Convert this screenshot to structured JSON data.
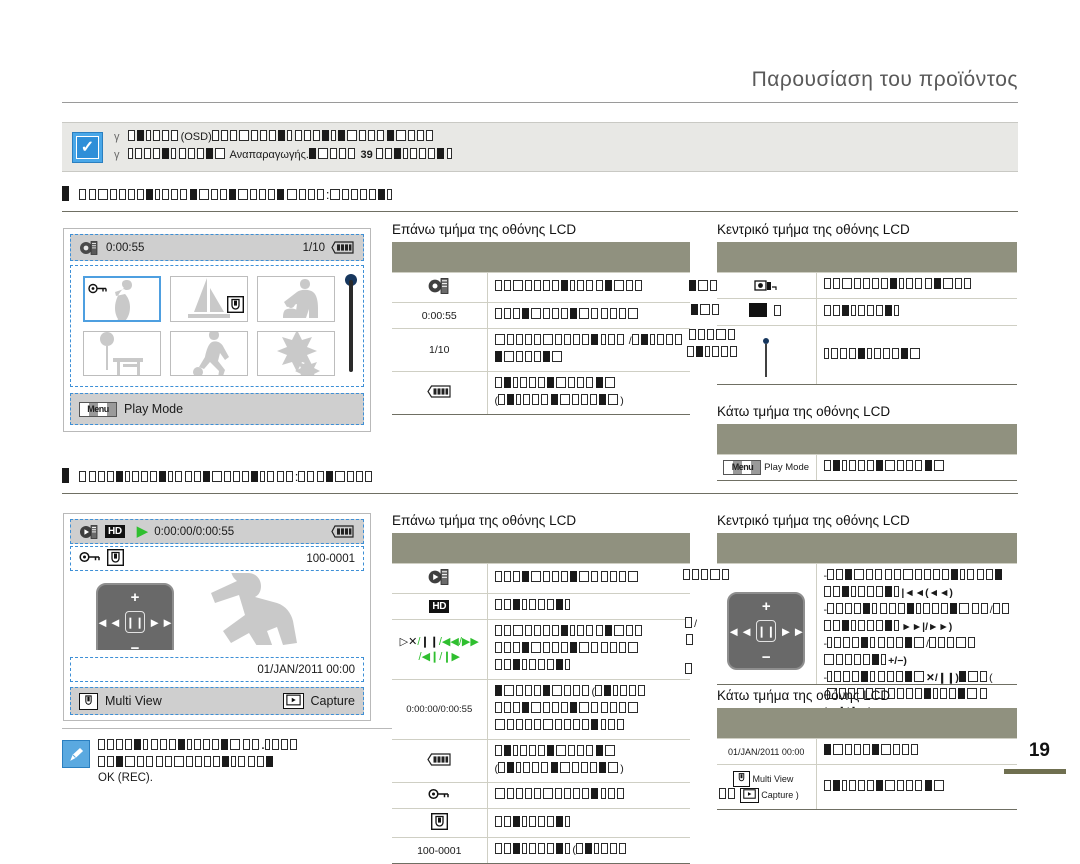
{
  "header": {
    "title": "Παρουσίαση  του προϊόντος"
  },
  "page_number": "19",
  "top_note": {
    "bullet": "γ",
    "line1_visible": "(OSD)",
    "line2_visible": "Αναπαραγωγής.",
    "line2_ref": "39",
    "tofu_note": "Greek body text renders as missing-glyph boxes"
  },
  "sections": [
    {
      "id": "section-thumbnail",
      "colon": ":"
    },
    {
      "id": "section-playback",
      "colon": ":"
    }
  ],
  "lcd_thumbnail": {
    "top": {
      "counter": "0:00:55",
      "index": "1/10"
    },
    "bottom": {
      "menu_chip": "Menu",
      "label": "Play Mode"
    },
    "thumbs": [
      {
        "icon": "key-icon",
        "image": "person-silhouette",
        "selected": true
      },
      {
        "icon": "video-icon",
        "image": "sailboat-silhouette",
        "selected": false
      },
      {
        "icon": "",
        "image": "people-silhouette",
        "selected": false
      },
      {
        "icon": "",
        "image": "park-silhouette",
        "selected": false
      },
      {
        "icon": "",
        "image": "soccer-silhouette",
        "selected": false
      },
      {
        "icon": "",
        "image": "leaf-silhouette",
        "selected": false
      }
    ]
  },
  "lcd_playback": {
    "top": {
      "quality": "HD",
      "time": "0:00:00/0:00:55"
    },
    "second": {
      "file_number": "100-0001"
    },
    "datetime": "01/JAN/2011 00:00",
    "bottom": {
      "left_label": "Multi View",
      "right_label": "Capture"
    },
    "pad": {
      "plus": "+",
      "minus": "−",
      "prev": "◄◄|",
      "pause": "❙❙",
      "next": "|►►"
    }
  },
  "tables": {
    "t1_title": "Επάνω τμήμα  της οθόνης  LCD",
    "t1_rows": [
      {
        "key": "video-mode-icon",
        "key_type": "icon"
      },
      {
        "key": "0:00:55",
        "key_type": "text"
      },
      {
        "key": "1/10",
        "key_type": "text"
      },
      {
        "key": "battery-icon",
        "key_type": "icon"
      }
    ],
    "t2_title": "Κεντρικό  τμήμα της οθόνης  LCD",
    "t2_rows": [
      {
        "key": "photo-icon",
        "key_type": "icon"
      },
      {
        "key": "black-square-icon",
        "key_type": "icon"
      },
      {
        "key": "scrollbar-icon",
        "key_type": "icon"
      }
    ],
    "t3_title": "Κάτω τμήμα της οθόνης  LCD",
    "t3_rows": [
      {
        "key_chip": "Menu",
        "key_label": "Play Mode"
      }
    ],
    "t4_title": "Επάνω τμήμα  της οθόνης  LCD",
    "t4_rows": [
      {
        "key": "play-mode-icon",
        "key_type": "icon"
      },
      {
        "key": "HD",
        "key_type": "badge"
      },
      {
        "key": "▷✕/❙❙/◀◀/▶▶ /◀❙/❙▶",
        "key_type": "playicons"
      },
      {
        "key": "0:00:00/0:00:55",
        "key_type": "text"
      },
      {
        "key": "battery-icon",
        "key_type": "icon"
      },
      {
        "key": "key-icon",
        "key_type": "icon"
      },
      {
        "key": "video-icon",
        "key_type": "icon"
      },
      {
        "key": "100-0001",
        "key_type": "text"
      }
    ],
    "t5_title": "Κεντρικό  τμήμα της οθόνης  LCD",
    "t5_rows": [
      {
        "key": "control-pad-icon",
        "key_type": "pad",
        "v_inline": [
          "|◄◄(◄◄)",
          "►►|/►►)",
          "+/−)",
          "✕/❙❙)",
          "(◄❙/❙►)"
        ]
      }
    ],
    "t6_title": "Κάτω τμήμα της οθόνης  LCD",
    "t6_rows": [
      {
        "key": "01/JAN/2011 00:00",
        "key_type": "text"
      },
      {
        "key_multi": "Multi View",
        "key_capture": "Capture"
      }
    ]
  },
  "bottom_note": {
    "visible_text": "OK (REC).",
    "period": "."
  }
}
